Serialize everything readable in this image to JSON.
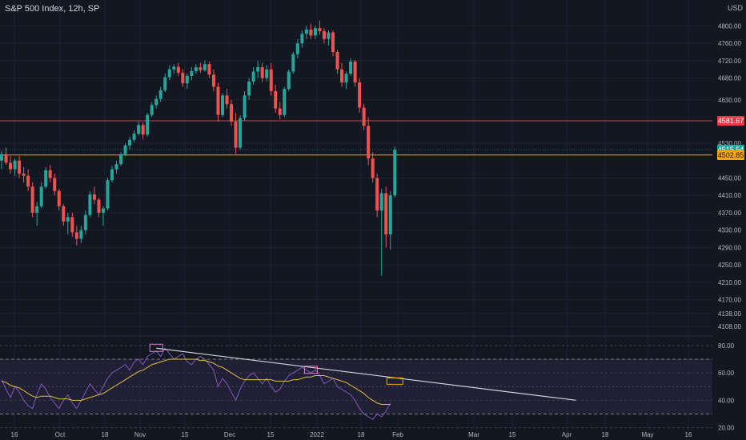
{
  "header": {
    "title": "S&P 500 Index, 12h, SP",
    "currency": "USD"
  },
  "colors": {
    "background": "#131722",
    "grid": "#1e222d",
    "up": "#26a69a",
    "down": "#ef5350",
    "resistance": "#f23645",
    "support": "#f7a600",
    "current": "#26a69a",
    "rsi_line": "#7e57c2",
    "rsi_ma": "#e0c040",
    "rsi_band": "#2a2540",
    "trendline": "#d1d4dc",
    "rsi_highlight": "#e07ad0",
    "rsi_target": "#f7a600"
  },
  "price_tags": {
    "resistance": "4581.67",
    "current": "4515.54",
    "support": "4502.85"
  },
  "chart_data": [
    {
      "type": "candlestick",
      "title": "S&P 500 Index, 12h, SP",
      "yaxis_labels": [
        "4800.00",
        "4760.00",
        "4720.00",
        "4680.00",
        "4630.00",
        "4581.67",
        "4530.00",
        "4450.00",
        "4410.00",
        "4370.00",
        "4330.00",
        "4290.00",
        "4250.00",
        "4210.00",
        "4170.00",
        "4138.00",
        "4108.00"
      ],
      "xaxis_labels": [
        "16",
        "Oct",
        "18",
        "Nov",
        "15",
        "Dec",
        "15",
        "2022",
        "18",
        "Feb",
        "Mar",
        "15",
        "Apr",
        "18",
        "May",
        "16"
      ],
      "ylim": [
        4090,
        4845
      ],
      "horizontal_lines": [
        {
          "value": 4581.67,
          "color": "#f23645"
        },
        {
          "value": 4502.85,
          "color": "#f7a600"
        },
        {
          "value": 4515.54,
          "color": "#26a69a",
          "style": "dotted"
        }
      ],
      "ohlc": [
        [
          4490,
          4512,
          4470,
          4505
        ],
        [
          4505,
          4520,
          4480,
          4485
        ],
        [
          4485,
          4500,
          4460,
          4470
        ],
        [
          4470,
          4495,
          4455,
          4490
        ],
        [
          4490,
          4500,
          4450,
          4460
        ],
        [
          4460,
          4475,
          4440,
          4455
        ],
        [
          4455,
          4470,
          4420,
          4430
        ],
        [
          4430,
          4440,
          4360,
          4370
        ],
        [
          4370,
          4395,
          4340,
          4385
        ],
        [
          4385,
          4440,
          4380,
          4430
        ],
        [
          4430,
          4475,
          4425,
          4468
        ],
        [
          4468,
          4480,
          4440,
          4450
        ],
        [
          4450,
          4460,
          4410,
          4420
        ],
        [
          4420,
          4425,
          4375,
          4385
        ],
        [
          4385,
          4390,
          4340,
          4350
        ],
        [
          4350,
          4370,
          4320,
          4360
        ],
        [
          4360,
          4370,
          4315,
          4325
        ],
        [
          4325,
          4340,
          4295,
          4310
        ],
        [
          4310,
          4340,
          4300,
          4330
        ],
        [
          4330,
          4375,
          4320,
          4365
        ],
        [
          4365,
          4420,
          4360,
          4412
        ],
        [
          4412,
          4430,
          4390,
          4400
        ],
        [
          4400,
          4405,
          4360,
          4370
        ],
        [
          4370,
          4385,
          4340,
          4380
        ],
        [
          4380,
          4450,
          4375,
          4445
        ],
        [
          4445,
          4478,
          4440,
          4470
        ],
        [
          4470,
          4490,
          4460,
          4482
        ],
        [
          4482,
          4510,
          4478,
          4505
        ],
        [
          4505,
          4530,
          4500,
          4525
        ],
        [
          4525,
          4545,
          4515,
          4538
        ],
        [
          4538,
          4560,
          4532,
          4552
        ],
        [
          4552,
          4580,
          4548,
          4572
        ],
        [
          4572,
          4578,
          4540,
          4550
        ],
        [
          4550,
          4600,
          4545,
          4595
        ],
        [
          4595,
          4625,
          4590,
          4618
        ],
        [
          4618,
          4640,
          4610,
          4632
        ],
        [
          4632,
          4660,
          4625,
          4652
        ],
        [
          4652,
          4690,
          4648,
          4682
        ],
        [
          4682,
          4710,
          4675,
          4700
        ],
        [
          4700,
          4712,
          4690,
          4706
        ],
        [
          4706,
          4715,
          4685,
          4692
        ],
        [
          4692,
          4700,
          4660,
          4668
        ],
        [
          4668,
          4690,
          4655,
          4685
        ],
        [
          4685,
          4705,
          4675,
          4696
        ],
        [
          4696,
          4712,
          4690,
          4705
        ],
        [
          4705,
          4715,
          4692,
          4698
        ],
        [
          4698,
          4720,
          4695,
          4712
        ],
        [
          4712,
          4718,
          4680,
          4688
        ],
        [
          4688,
          4700,
          4650,
          4660
        ],
        [
          4660,
          4670,
          4580,
          4595
        ],
        [
          4595,
          4645,
          4590,
          4640
        ],
        [
          4640,
          4655,
          4610,
          4620
        ],
        [
          4620,
          4630,
          4570,
          4580
        ],
        [
          4580,
          4600,
          4505,
          4520
        ],
        [
          4520,
          4595,
          4515,
          4588
        ],
        [
          4588,
          4650,
          4582,
          4640
        ],
        [
          4640,
          4680,
          4630,
          4672
        ],
        [
          4672,
          4705,
          4665,
          4695
        ],
        [
          4695,
          4720,
          4680,
          4705
        ],
        [
          4705,
          4715,
          4670,
          4680
        ],
        [
          4680,
          4710,
          4672,
          4700
        ],
        [
          4700,
          4715,
          4640,
          4650
        ],
        [
          4650,
          4665,
          4600,
          4610
        ],
        [
          4610,
          4625,
          4585,
          4595
        ],
        [
          4595,
          4660,
          4590,
          4655
        ],
        [
          4655,
          4700,
          4650,
          4695
        ],
        [
          4695,
          4740,
          4690,
          4735
        ],
        [
          4735,
          4770,
          4725,
          4760
        ],
        [
          4760,
          4790,
          4750,
          4782
        ],
        [
          4782,
          4800,
          4770,
          4792
        ],
        [
          4792,
          4805,
          4770,
          4778
        ],
        [
          4778,
          4800,
          4770,
          4795
        ],
        [
          4795,
          4812,
          4780,
          4788
        ],
        [
          4788,
          4795,
          4760,
          4770
        ],
        [
          4770,
          4790,
          4755,
          4785
        ],
        [
          4785,
          4790,
          4730,
          4740
        ],
        [
          4740,
          4745,
          4690,
          4700
        ],
        [
          4700,
          4715,
          4660,
          4670
        ],
        [
          4670,
          4695,
          4655,
          4690
        ],
        [
          4690,
          4725,
          4685,
          4718
        ],
        [
          4718,
          4722,
          4660,
          4670
        ],
        [
          4670,
          4680,
          4600,
          4612
        ],
        [
          4612,
          4620,
          4560,
          4570
        ],
        [
          4570,
          4590,
          4480,
          4495
        ],
        [
          4495,
          4510,
          4440,
          4450
        ],
        [
          4450,
          4460,
          4360,
          4375
        ],
        [
          4375,
          4425,
          4225,
          4415
        ],
        [
          4415,
          4430,
          4290,
          4320
        ],
        [
          4320,
          4420,
          4285,
          4410
        ],
        [
          4410,
          4522,
          4405,
          4515
        ]
      ],
      "series_name": "S&P 500 Index"
    },
    {
      "type": "line",
      "yaxis_labels": [
        "80.00",
        "60.00",
        "40.00",
        "20.00"
      ],
      "ylim": [
        18,
        84
      ],
      "bands": [
        30,
        70
      ],
      "trendline": [
        [
          35,
          78
        ],
        [
          130,
          40
        ]
      ],
      "highlight_boxes": [
        [
          35,
          78
        ],
        [
          70,
          62
        ]
      ],
      "target_box": [
        89,
        54
      ],
      "series": [
        {
          "name": "RSI",
          "values": [
            55,
            48,
            42,
            50,
            46,
            40,
            36,
            34,
            44,
            52,
            48,
            42,
            38,
            34,
            40,
            44,
            38,
            34,
            40,
            46,
            52,
            48,
            44,
            50,
            56,
            60,
            62,
            64,
            66,
            62,
            68,
            70,
            66,
            72,
            74,
            76,
            72,
            78,
            74,
            70,
            72,
            74,
            68,
            66,
            70,
            72,
            70,
            66,
            62,
            50,
            56,
            52,
            46,
            40,
            48,
            54,
            58,
            60,
            56,
            52,
            56,
            50,
            46,
            48,
            54,
            58,
            60,
            62,
            64,
            62,
            60,
            62,
            58,
            52,
            54,
            56,
            50,
            48,
            46,
            44,
            40,
            34,
            30,
            28,
            26,
            30,
            28,
            32,
            38
          ]
        },
        {
          "name": "RSI MA",
          "values": [
            54,
            53,
            51,
            50,
            49,
            47,
            45,
            43,
            42,
            43,
            43,
            43,
            42,
            41,
            41,
            41,
            40,
            40,
            40,
            41,
            42,
            43,
            44,
            45,
            47,
            49,
            51,
            53,
            55,
            57,
            59,
            61,
            62,
            64,
            66,
            67,
            68,
            69,
            70,
            70,
            70,
            70,
            70,
            70,
            70,
            69,
            69,
            68,
            67,
            65,
            64,
            62,
            60,
            58,
            56,
            55,
            55,
            55,
            55,
            55,
            55,
            55,
            54,
            54,
            54,
            54,
            55,
            55,
            56,
            57,
            57,
            58,
            58,
            58,
            57,
            56,
            55,
            54,
            53,
            51,
            49,
            47,
            45,
            42,
            40,
            38,
            37,
            37,
            37
          ]
        }
      ]
    }
  ]
}
